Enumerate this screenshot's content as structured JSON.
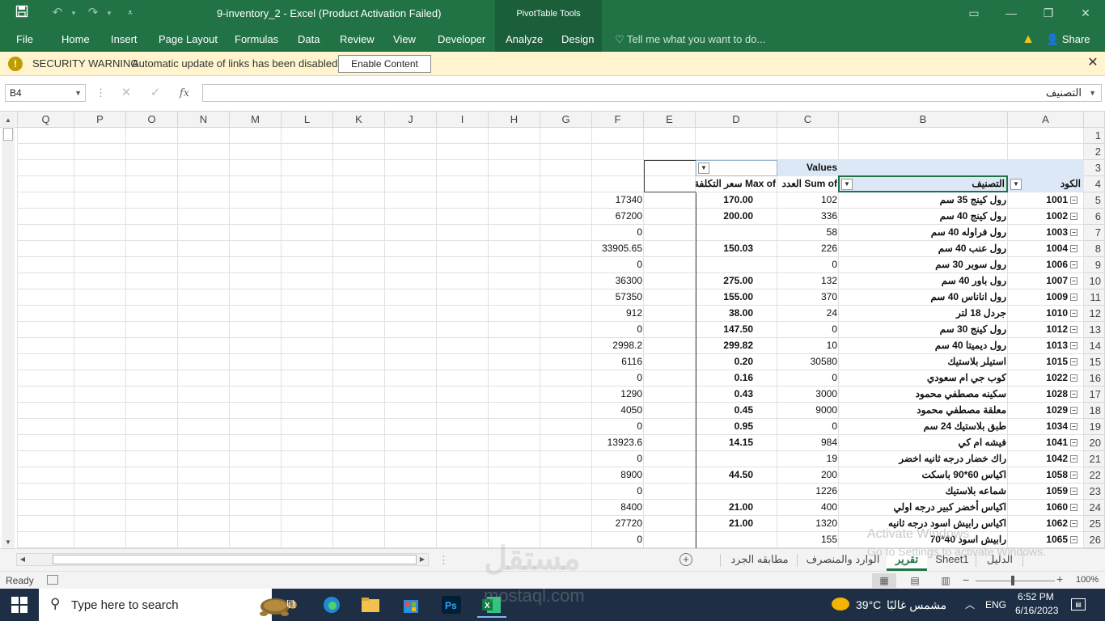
{
  "window": {
    "title": "9-inventory_2 - Excel (Product Activation Failed)",
    "context_header": "PivotTable Tools"
  },
  "ribbon": {
    "tabs": [
      "File",
      "Home",
      "Insert",
      "Page Layout",
      "Formulas",
      "Data",
      "Review",
      "View",
      "Developer",
      "Analyze",
      "Design"
    ],
    "tell_me": "Tell me what you want to do...",
    "share": "Share"
  },
  "security": {
    "title": "SECURITY WARNING",
    "message": "Automatic update of links has been disabled",
    "button": "Enable Content",
    "icon": "!"
  },
  "formula_bar": {
    "name_box": "B4",
    "fx": "fx",
    "formula": "التصنيف"
  },
  "grid": {
    "columns": [
      "Q",
      "P",
      "O",
      "N",
      "M",
      "L",
      "K",
      "J",
      "I",
      "H",
      "G",
      "F",
      "E",
      "D",
      "C",
      "B",
      "A"
    ],
    "row_numbers": [
      "1",
      "2",
      "3",
      "4",
      "5",
      "6",
      "7",
      "8",
      "9",
      "10",
      "11",
      "12",
      "13",
      "14",
      "15",
      "16",
      "17",
      "18",
      "19",
      "20",
      "21",
      "22",
      "23",
      "24",
      "25",
      "26"
    ]
  },
  "pivot": {
    "values_label": "Values",
    "headers": {
      "code": "الكود",
      "category": "التصنيف",
      "sum_qty": "Sum of العدد",
      "max_cost": "Max of سعر التكلفة"
    },
    "rows": [
      {
        "code": "1001",
        "name": "رول كينج 35 سم",
        "qty": "102",
        "max": "170.00",
        "f": "17340"
      },
      {
        "code": "1002",
        "name": "رول كينج 40 سم",
        "qty": "336",
        "max": "200.00",
        "f": "67200"
      },
      {
        "code": "1003",
        "name": "رول فراوله 40 سم",
        "qty": "58",
        "max": "",
        "f": "0"
      },
      {
        "code": "1004",
        "name": "رول عنب 40 سم",
        "qty": "226",
        "max": "150.03",
        "f": "33905.65"
      },
      {
        "code": "1006",
        "name": "رول سوبر 30 سم",
        "qty": "0",
        "max": "",
        "f": "0"
      },
      {
        "code": "1007",
        "name": "رول باور 40 سم",
        "qty": "132",
        "max": "275.00",
        "f": "36300"
      },
      {
        "code": "1009",
        "name": "رول اناناس 40 سم",
        "qty": "370",
        "max": "155.00",
        "f": "57350"
      },
      {
        "code": "1010",
        "name": "جردل 18 لتر",
        "qty": "24",
        "max": "38.00",
        "f": "912"
      },
      {
        "code": "1012",
        "name": "رول كينج 30 سم",
        "qty": "0",
        "max": "147.50",
        "f": "0"
      },
      {
        "code": "1013",
        "name": "رول ديميتا 40 سم",
        "qty": "10",
        "max": "299.82",
        "f": "2998.2"
      },
      {
        "code": "1015",
        "name": "استيلر بلاستيك",
        "qty": "30580",
        "max": "0.20",
        "f": "6116"
      },
      {
        "code": "1022",
        "name": "كوب جي ام سعودي",
        "qty": "0",
        "max": "0.16",
        "f": "0"
      },
      {
        "code": "1028",
        "name": "سكينه مصطفي محمود",
        "qty": "3000",
        "max": "0.43",
        "f": "1290"
      },
      {
        "code": "1029",
        "name": "معلقة مصطفي محمود",
        "qty": "9000",
        "max": "0.45",
        "f": "4050"
      },
      {
        "code": "1034",
        "name": "طبق بلاستيك 24 سم",
        "qty": "0",
        "max": "0.95",
        "f": "0"
      },
      {
        "code": "1041",
        "name": "فيشه ام كي",
        "qty": "984",
        "max": "14.15",
        "f": "13923.6"
      },
      {
        "code": "1042",
        "name": "راك خضار درجه ثانيه اخضر",
        "qty": "19",
        "max": "",
        "f": "0"
      },
      {
        "code": "1058",
        "name": "اكياس 60*90 باسكت",
        "qty": "200",
        "max": "44.50",
        "f": "8900"
      },
      {
        "code": "1059",
        "name": "شماعه بلاستيك",
        "qty": "1226",
        "max": "",
        "f": "0"
      },
      {
        "code": "1060",
        "name": "اكياس أخضر كبير درجه اولي",
        "qty": "400",
        "max": "21.00",
        "f": "8400"
      },
      {
        "code": "1062",
        "name": "اكياس رابيش اسود درجه ثانيه",
        "qty": "1320",
        "max": "21.00",
        "f": "27720"
      },
      {
        "code": "1065",
        "name": "رابيش اسود 40*70",
        "qty": "155",
        "max": "",
        "f": "0"
      }
    ]
  },
  "sheet_tabs": {
    "tabs": [
      "الدليل",
      "Sheet1",
      "تقرير",
      "الوارد والمنصرف",
      "مطابقه الجرد"
    ],
    "active": "تقرير"
  },
  "watermark": {
    "line1": "Activate Windows",
    "line2": "Go to Settings to activate Windows.",
    "brand": "مستقل",
    "brand_url": "mostaql.com"
  },
  "status": {
    "ready": "Ready",
    "zoom": "100%"
  },
  "taskbar": {
    "search": "Type here to search",
    "weather_temp": "39°C",
    "weather_desc": "مشمس غالبًا",
    "lang": "ENG",
    "time": "6:52 PM",
    "date": "6/16/2023"
  },
  "colors": {
    "excel_green": "#217346",
    "security_bar": "#fff4ce",
    "pivot_header": "#dce8f5",
    "taskbar": "#1e2f45"
  }
}
